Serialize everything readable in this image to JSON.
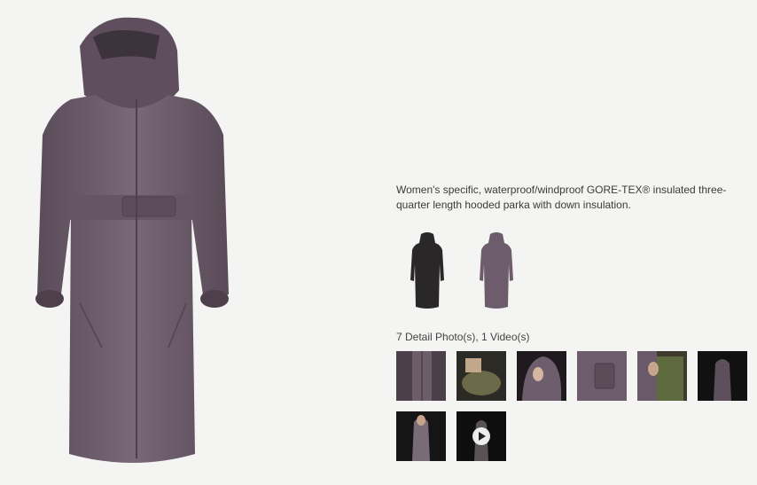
{
  "product": {
    "description": "Women's specific, waterproof/windproof GORE-TEX® insulated three-quarter length hooded parka with down insulation.",
    "main_image_color": "#6b5b6a"
  },
  "swatches": [
    {
      "name": "black-swatch",
      "color": "#2a2728"
    },
    {
      "name": "purple-swatch",
      "color": "#6d5d6c"
    }
  ],
  "details": {
    "count_label": "7 Detail Photo(s), 1 Video(s)"
  },
  "colors": {
    "jacket": "#6b5b6a",
    "jacket_dark": "#4f424f",
    "background": "#f4f4f2"
  }
}
